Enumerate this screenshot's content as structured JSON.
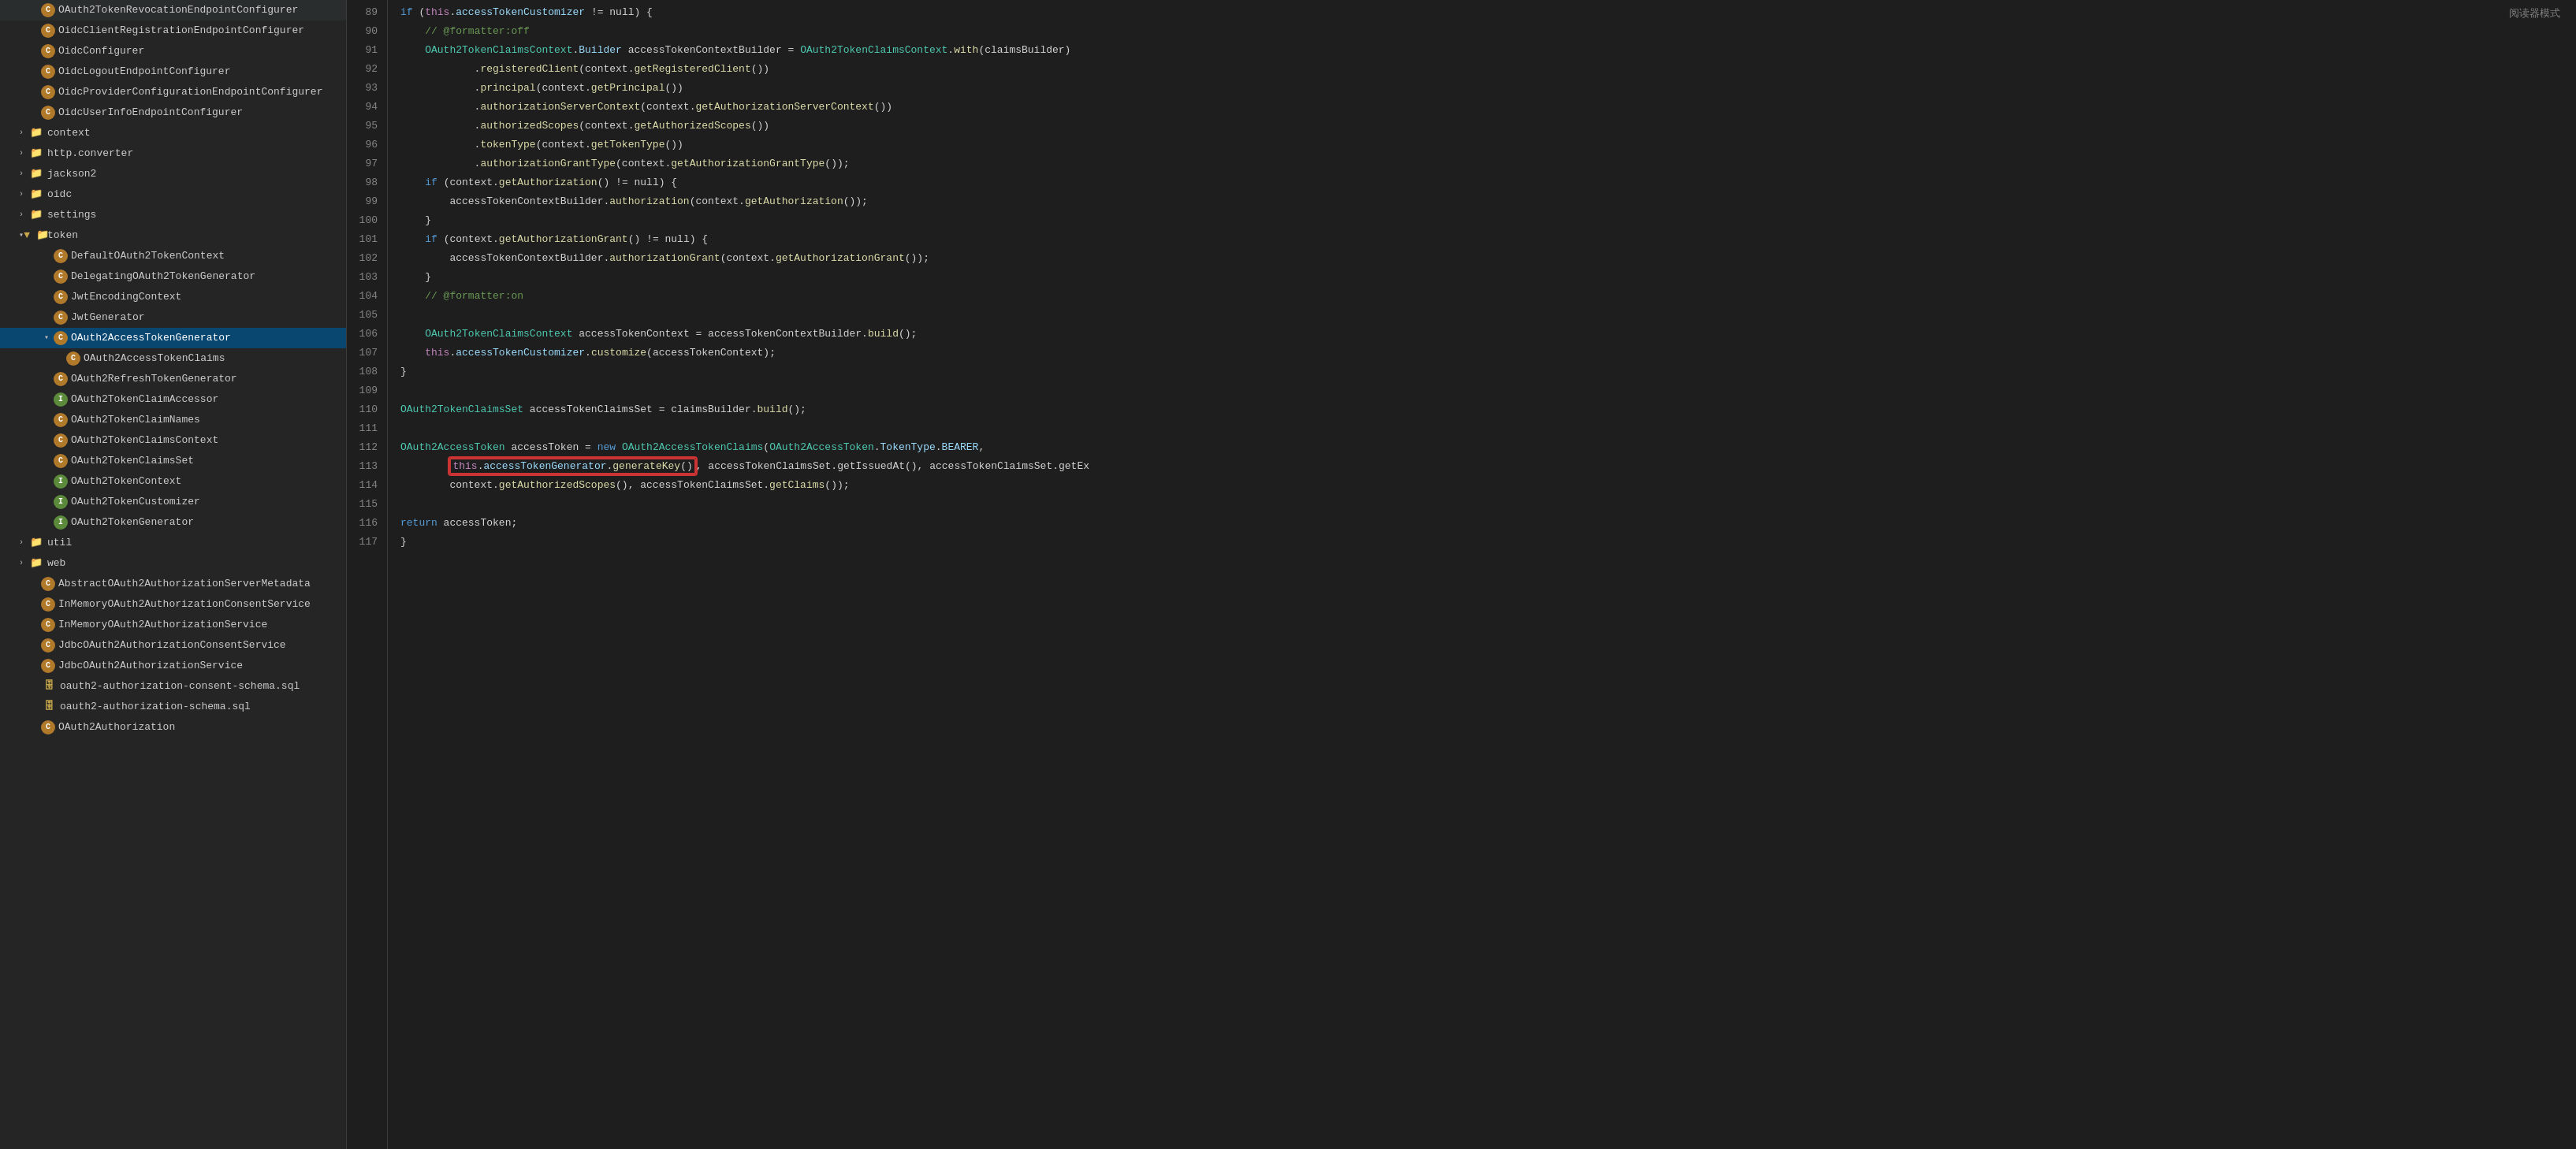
{
  "sidebar": {
    "items": [
      {
        "label": "OAuth2TokenRevocationEndpointConfigurer",
        "type": "c",
        "indent": 2
      },
      {
        "label": "OidcClientRegistrationEndpointConfigurer",
        "type": "c",
        "indent": 2
      },
      {
        "label": "OidcConfigurer",
        "type": "c",
        "indent": 2
      },
      {
        "label": "OidcLogoutEndpointConfigurer",
        "type": "c",
        "indent": 2
      },
      {
        "label": "OidcProviderConfigurationEndpointConfigurer",
        "type": "c",
        "indent": 2
      },
      {
        "label": "OidcUserInfoEndpointConfigurer",
        "type": "c",
        "indent": 2
      },
      {
        "label": "context",
        "type": "folder",
        "indent": 1,
        "expanded": false
      },
      {
        "label": "http.converter",
        "type": "folder",
        "indent": 1,
        "expanded": false
      },
      {
        "label": "jackson2",
        "type": "folder",
        "indent": 1,
        "expanded": false
      },
      {
        "label": "oidc",
        "type": "folder",
        "indent": 1,
        "expanded": false
      },
      {
        "label": "settings",
        "type": "folder",
        "indent": 1,
        "expanded": false
      },
      {
        "label": "token",
        "type": "folder",
        "indent": 1,
        "expanded": true
      },
      {
        "label": "DefaultOAuth2TokenContext",
        "type": "c",
        "indent": 3
      },
      {
        "label": "DelegatingOAuth2TokenGenerator",
        "type": "c",
        "indent": 3
      },
      {
        "label": "JwtEncodingContext",
        "type": "c",
        "indent": 3
      },
      {
        "label": "JwtGenerator",
        "type": "c",
        "indent": 3
      },
      {
        "label": "OAuth2AccessTokenGenerator",
        "type": "c",
        "indent": 3,
        "selected": true
      },
      {
        "label": "OAuth2AccessTokenClaims",
        "type": "c",
        "indent": 4
      },
      {
        "label": "OAuth2RefreshTokenGenerator",
        "type": "c",
        "indent": 3
      },
      {
        "label": "OAuth2TokenClaimAccessor",
        "type": "i",
        "indent": 3
      },
      {
        "label": "OAuth2TokenClaimNames",
        "type": "c",
        "indent": 3
      },
      {
        "label": "OAuth2TokenClaimsContext",
        "type": "c",
        "indent": 3
      },
      {
        "label": "OAuth2TokenClaimsSet",
        "type": "c",
        "indent": 3
      },
      {
        "label": "OAuth2TokenContext",
        "type": "i",
        "indent": 3
      },
      {
        "label": "OAuth2TokenCustomizer",
        "type": "i",
        "indent": 3
      },
      {
        "label": "OAuth2TokenGenerator",
        "type": "i",
        "indent": 3
      },
      {
        "label": "util",
        "type": "folder",
        "indent": 1,
        "expanded": false
      },
      {
        "label": "web",
        "type": "folder",
        "indent": 1,
        "expanded": false
      },
      {
        "label": "AbstractOAuth2AuthorizationServerMetadata",
        "type": "c",
        "indent": 2
      },
      {
        "label": "InMemoryOAuth2AuthorizationConsentService",
        "type": "c",
        "indent": 2
      },
      {
        "label": "InMemoryOAuth2AuthorizationService",
        "type": "c",
        "indent": 2
      },
      {
        "label": "JdbcOAuth2AuthorizationConsentService",
        "type": "c",
        "indent": 2
      },
      {
        "label": "JdbcOAuth2AuthorizationService",
        "type": "c",
        "indent": 2
      },
      {
        "label": "oauth2-authorization-consent-schema.sql",
        "type": "sql",
        "indent": 2
      },
      {
        "label": "oauth2-authorization-schema.sql",
        "type": "sql",
        "indent": 2
      },
      {
        "label": "OAuth2Authorization",
        "type": "c",
        "indent": 2
      }
    ]
  },
  "editor": {
    "reader_mode": "阅读器模式",
    "lines": [
      {
        "num": "89",
        "code": "if (this.accessTokenCustomizer != null) {"
      },
      {
        "num": "90",
        "code": "    // @formatter:off"
      },
      {
        "num": "91",
        "code": "    OAuth2TokenClaimsContext.Builder accessTokenContextBuilder = OAuth2TokenClaimsContext.with(claimsBuilder)"
      },
      {
        "num": "92",
        "code": "            .registeredClient(context.getRegisteredClient())"
      },
      {
        "num": "93",
        "code": "            .principal(context.getPrincipal())"
      },
      {
        "num": "94",
        "code": "            .authorizationServerContext(context.getAuthorizationServerContext())"
      },
      {
        "num": "95",
        "code": "            .authorizedScopes(context.getAuthorizedScopes())"
      },
      {
        "num": "96",
        "code": "            .tokenType(context.getTokenType())"
      },
      {
        "num": "97",
        "code": "            .authorizationGrantType(context.getAuthorizationGrantType());"
      },
      {
        "num": "98",
        "code": "    if (context.getAuthorization() != null) {"
      },
      {
        "num": "99",
        "code": "        accessTokenContextBuilder.authorization(context.getAuthorization());"
      },
      {
        "num": "100",
        "code": "    }"
      },
      {
        "num": "101",
        "code": "    if (context.getAuthorizationGrant() != null) {"
      },
      {
        "num": "102",
        "code": "        accessTokenContextBuilder.authorizationGrant(context.getAuthorizationGrant());"
      },
      {
        "num": "103",
        "code": "    }"
      },
      {
        "num": "104",
        "code": "    // @formatter:on"
      },
      {
        "num": "105",
        "code": ""
      },
      {
        "num": "106",
        "code": "    OAuth2TokenClaimsContext accessTokenContext = accessTokenContextBuilder.build();"
      },
      {
        "num": "107",
        "code": "    this.accessTokenCustomizer.customize(accessTokenContext);"
      },
      {
        "num": "108",
        "code": "}"
      },
      {
        "num": "109",
        "code": ""
      },
      {
        "num": "110",
        "code": "OAuth2TokenClaimsSet accessTokenClaimsSet = claimsBuilder.build();"
      },
      {
        "num": "111",
        "code": ""
      },
      {
        "num": "112",
        "code": "OAuth2AccessToken accessToken = new OAuth2AccessTokenClaims(OAuth2AccessToken.TokenType.BEARER,"
      },
      {
        "num": "113",
        "code": "        this.accessTokenGenerator.generateKey(), accessTokenClaimsSet.getIssuedAt(), accessTokenClaimsSet.getEx"
      },
      {
        "num": "114",
        "code": "        context.getAuthorizedScopes(), accessTokenClaimsSet.getClaims());"
      },
      {
        "num": "115",
        "code": ""
      },
      {
        "num": "116",
        "code": "return accessToken;"
      },
      {
        "num": "117",
        "code": "}"
      }
    ]
  }
}
